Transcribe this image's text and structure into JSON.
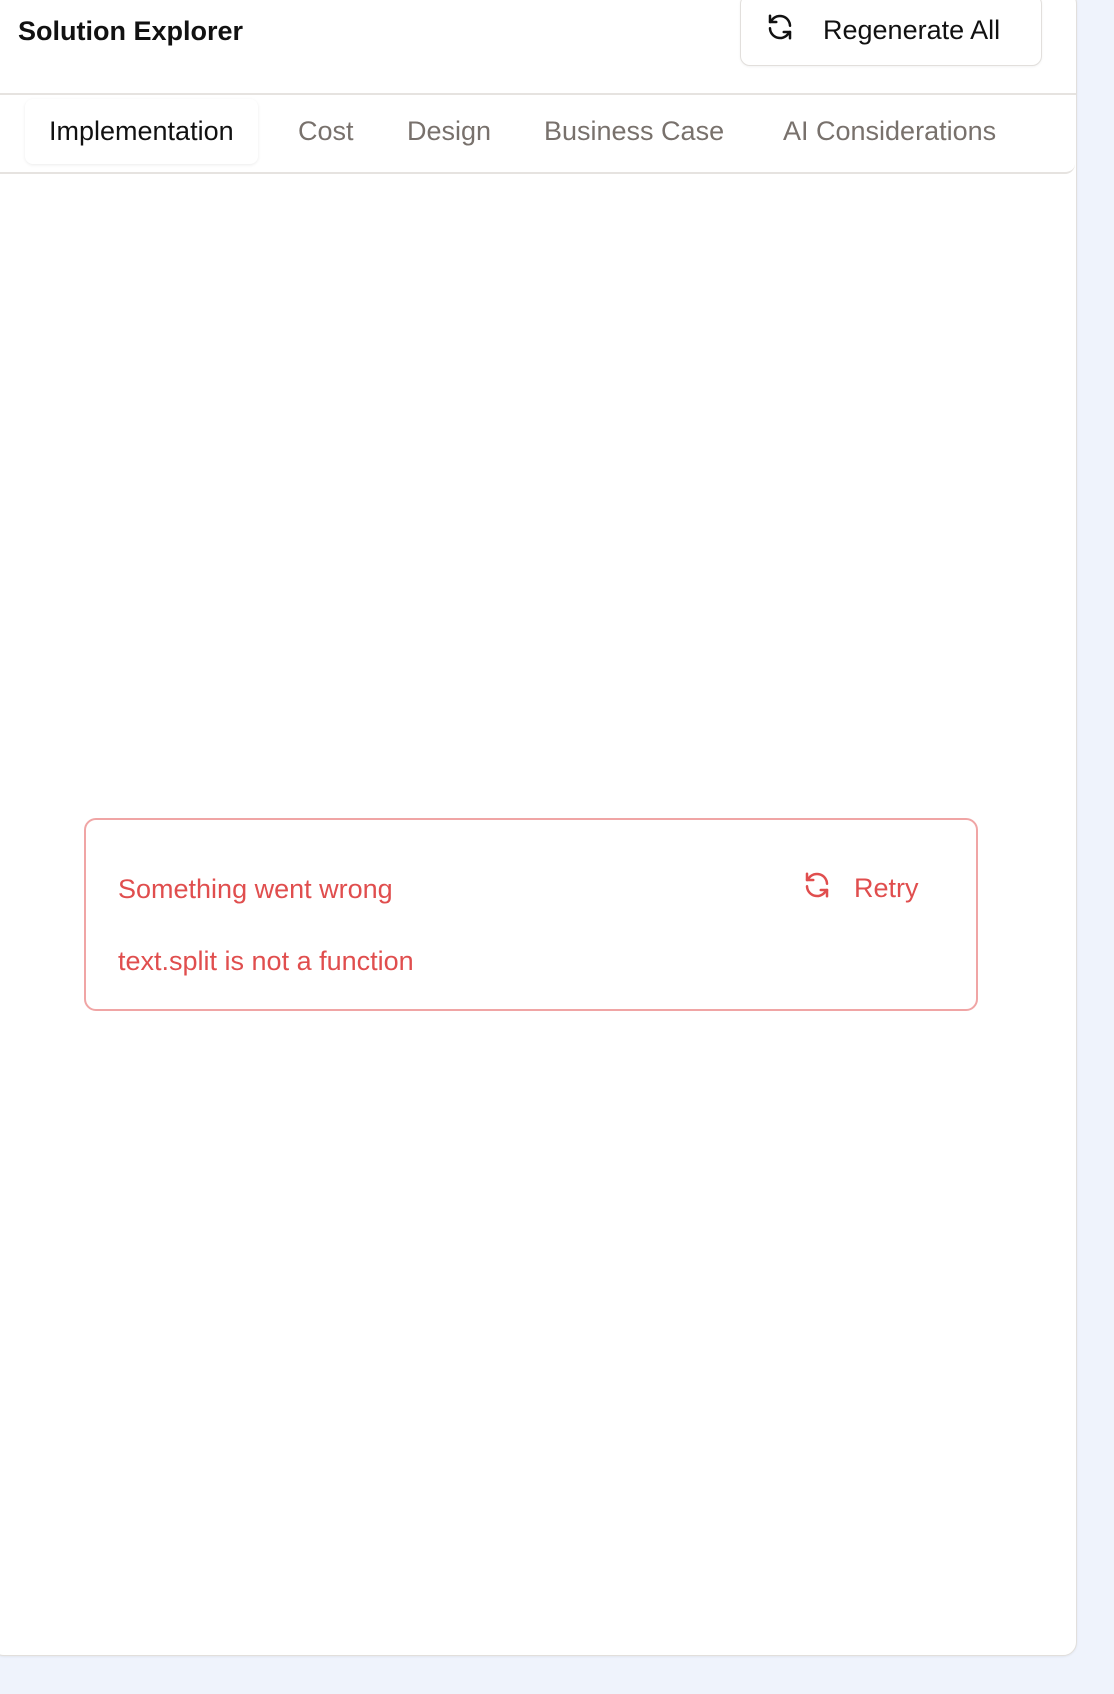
{
  "header": {
    "title": "Solution Explorer",
    "regenerate_label": "Regenerate All"
  },
  "tabs": [
    {
      "label": "Implementation",
      "active": true
    },
    {
      "label": "Cost"
    },
    {
      "label": "Design"
    },
    {
      "label": "Business Case"
    },
    {
      "label": "AI Considerations"
    }
  ],
  "error": {
    "title": "Something went wrong",
    "message": "text.split is not a function",
    "retry_label": "Retry",
    "color": "#e04e4e"
  },
  "colors": {
    "background": "#eff3fc",
    "panel": "#ffffff",
    "tab_inactive": "#78716c"
  }
}
